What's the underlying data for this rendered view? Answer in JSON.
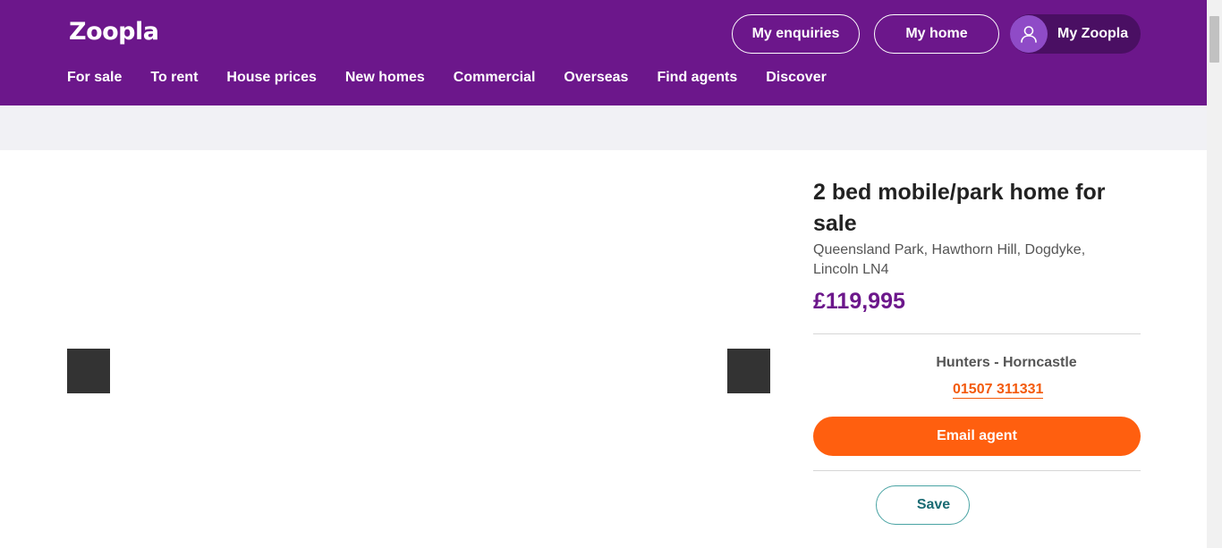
{
  "header": {
    "logo": "Zoopla",
    "nav": [
      "For sale",
      "To rent",
      "House prices",
      "New homes",
      "Commercial",
      "Overseas",
      "Find agents",
      "Discover"
    ],
    "my_enquiries": "My enquiries",
    "my_home": "My home",
    "my_zoopla": "My Zoopla",
    "avatar_icon": "user-icon"
  },
  "listing": {
    "title": "2 bed mobile/park home for sale",
    "address": "Queensland Park, Hawthorn Hill, Dogdyke, Lincoln LN4",
    "price": "£119,995"
  },
  "agent": {
    "name": "Hunters - Horncastle",
    "phone": "01507 311331",
    "email_label": "Email agent"
  },
  "actions": {
    "save_label": "Save"
  },
  "colors": {
    "brand_purple": "#6c178b",
    "cta_orange": "#ff5f0f",
    "phone_orange": "#f35a0c",
    "save_teal": "#49a3a3"
  }
}
